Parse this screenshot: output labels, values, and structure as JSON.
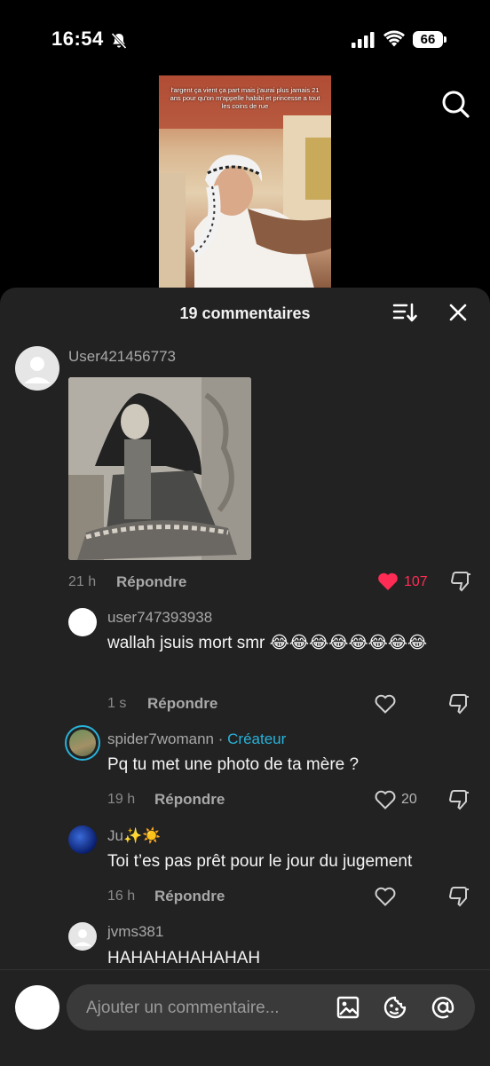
{
  "status_bar": {
    "time": "16:54",
    "battery": "66"
  },
  "video": {
    "caption": "l'argent ça vient ça part mais j'aurai plus jamais 21 ans pour qu'on m'appelle habibi et princesse a tout les coins de rue"
  },
  "sheet": {
    "title": "19 commentaires"
  },
  "comments": [
    {
      "username": "User421456773",
      "time": "21 h",
      "reply_label": "Répondre",
      "likes": "107"
    },
    {
      "username": "user747393938",
      "text": "wallah jsuis mort smr 😂😂😂😂😂😂😂😂",
      "time": "1 s",
      "reply_label": "Répondre"
    },
    {
      "username": "spider7womann",
      "creator_tag": "Créateur",
      "text": "Pq tu met une photo de ta mère ?",
      "time": "19 h",
      "reply_label": "Répondre",
      "likes": "20"
    },
    {
      "username": "Ju✨☀️",
      "text": "Toi t’es pas prêt pour le jour du jugement",
      "time": "16 h",
      "reply_label": "Répondre"
    },
    {
      "username": "jvms381",
      "text": "HAHAHAHAHAHAH"
    }
  ],
  "input": {
    "placeholder": "Ajouter un commentaire..."
  },
  "icons": [
    "bell-off-icon",
    "signal-icon",
    "wifi-icon",
    "battery-icon",
    "search-icon",
    "sort-icon",
    "close-icon",
    "heart-icon",
    "dislike-icon",
    "image-icon",
    "emoji-icon",
    "mention-icon"
  ],
  "colors": {
    "like_red": "#fe2c55",
    "creator_blue": "#29b2d9",
    "sheet_bg": "#222222"
  }
}
